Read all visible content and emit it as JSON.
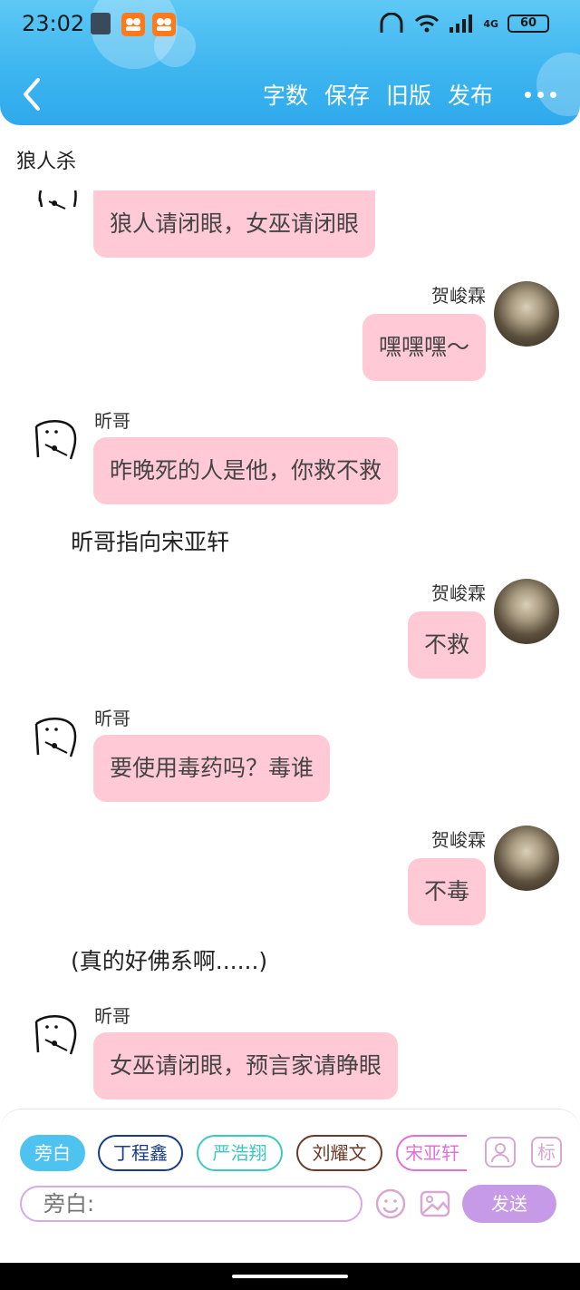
{
  "status_bar": {
    "time": "23:02",
    "battery": "60",
    "network": "4G"
  },
  "nav": {
    "actions": [
      "字数",
      "保存",
      "旧版",
      "发布"
    ]
  },
  "chat_title": "狼人杀",
  "messages": [
    {
      "name": "",
      "text": "狼人请闭眼，女巫请闭眼"
    },
    {
      "name": "贺峻霖",
      "text": "嘿嘿嘿～"
    },
    {
      "name": "昕哥",
      "text": "昨晚死的人是他，你救不救"
    },
    {
      "narration": "昕哥指向宋亚轩"
    },
    {
      "name": "贺峻霖",
      "text": "不救"
    },
    {
      "name": "昕哥",
      "text": "要使用毒药吗？毒谁"
    },
    {
      "name": "贺峻霖",
      "text": "不毒"
    },
    {
      "narration": "(真的好佛系啊......)"
    },
    {
      "name": "昕哥",
      "text": "女巫请闭眼，预言家请睁眼"
    }
  ],
  "roles": [
    "旁白",
    "丁程鑫",
    "严浩翔",
    "刘耀文",
    "宋亚轩"
  ],
  "role_colors": [
    "#4fc3f0",
    "#1a3a8a",
    "#3cc9c0",
    "#6b3a2a",
    "#e070d8"
  ],
  "tool_marker": "标",
  "input": {
    "placeholder": "旁白:"
  },
  "send_label": "发送"
}
